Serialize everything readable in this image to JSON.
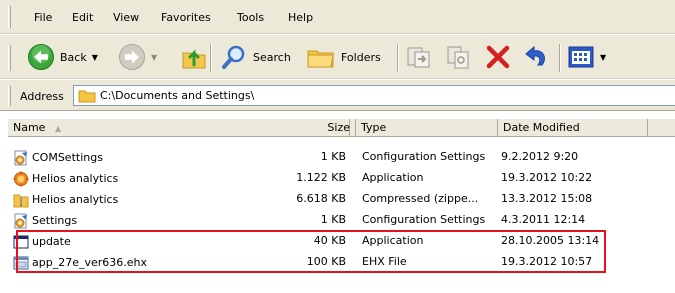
{
  "menu": {
    "items": [
      "File",
      "Edit",
      "View",
      "Favorites",
      "Tools",
      "Help"
    ]
  },
  "toolbar": {
    "back_label": "Back",
    "search_label": "Search",
    "folders_label": "Folders"
  },
  "address": {
    "label": "Address",
    "value": "C:\\Documents and Settings\\"
  },
  "columns": {
    "name": "Name",
    "size": "Size",
    "type": "Type",
    "date": "Date Modified"
  },
  "files": [
    {
      "name": "COMSettings",
      "size": "1 KB",
      "type": "Configuration Settings",
      "date": "9.2.2012 9:20",
      "icon": "config-settings-icon"
    },
    {
      "name": "Helios analytics",
      "size": "1.122 KB",
      "type": "Application",
      "date": "19.3.2012 10:22",
      "icon": "helios-app-icon"
    },
    {
      "name": "Helios analytics",
      "size": "6.618 KB",
      "type": "Compressed (zippe...",
      "date": "13.3.2012 15:08",
      "icon": "zip-folder-icon"
    },
    {
      "name": "Settings",
      "size": "1 KB",
      "type": "Configuration Settings",
      "date": "4.3.2011 12:14",
      "icon": "config-settings-icon"
    },
    {
      "name": "update",
      "size": "40 KB",
      "type": "Application",
      "date": "28.10.2005 13:14",
      "icon": "application-window-icon"
    },
    {
      "name": "app_27e_ver636.ehx",
      "size": "100 KB",
      "type": "EHX File",
      "date": "19.3.2012 10:57",
      "icon": "ehx-file-icon"
    }
  ],
  "colors": {
    "highlight": "#e8101b",
    "chrome": "#ece9d8",
    "delete_red": "#d42020",
    "back_green": "#2e9a2e"
  }
}
